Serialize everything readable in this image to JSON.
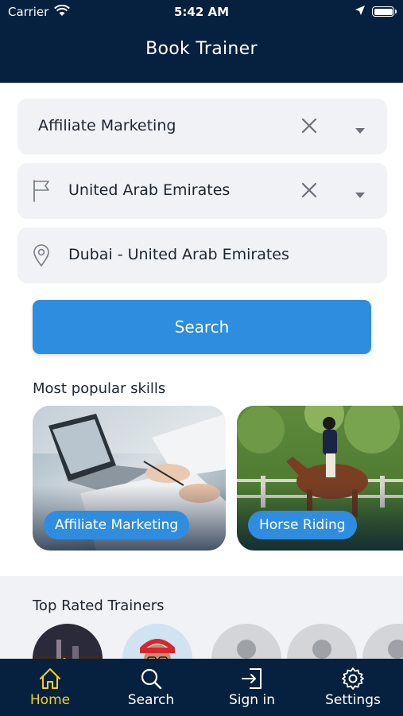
{
  "status_bar": {
    "carrier": "Carrier",
    "time": "5:42 AM"
  },
  "header": {
    "title": "Book Trainer"
  },
  "search_form": {
    "skill_field": {
      "value": "Affiliate Marketing",
      "clear_icon": "close-icon",
      "dropdown_icon": "chevron-down-icon"
    },
    "country_field": {
      "value": "United Arab Emirates",
      "icon": "flag-icon",
      "clear_icon": "close-icon",
      "dropdown_icon": "chevron-down-icon"
    },
    "city_field": {
      "value": "Dubai - United Arab Emirates",
      "icon": "location-pin-icon"
    },
    "search_button_label": "Search"
  },
  "popular_skills": {
    "title": "Most popular skills",
    "items": [
      {
        "label": "Affiliate Marketing"
      },
      {
        "label": "Horse Riding"
      }
    ]
  },
  "top_trainers": {
    "title": "Top Rated Trainers"
  },
  "tabbar": {
    "items": [
      {
        "label": "Home",
        "icon": "home-icon",
        "active": true
      },
      {
        "label": "Search",
        "icon": "search-icon",
        "active": false
      },
      {
        "label": "Sign in",
        "icon": "sign-in-icon",
        "active": false
      },
      {
        "label": "Settings",
        "icon": "gear-icon",
        "active": false
      }
    ]
  },
  "colors": {
    "header_bg": "#06213f",
    "accent_blue": "#2f8de0",
    "active_tab": "#f2d021"
  }
}
